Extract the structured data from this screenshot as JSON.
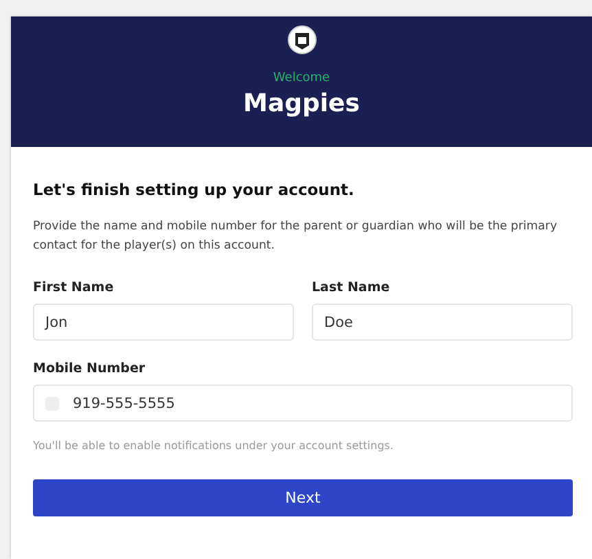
{
  "header": {
    "welcome": "Welcome",
    "title": "Magpies"
  },
  "form": {
    "heading": "Let's finish setting up your account.",
    "intro": "Provide the name and mobile number for the parent or guardian who will be the primary contact for the player(s) on this account.",
    "fields": [
      {
        "label": "First Name",
        "value": "Jon"
      },
      {
        "label": "Last Name",
        "value": "Doe"
      }
    ],
    "mobile": {
      "label": "Mobile Number",
      "value": "919-555-5555"
    },
    "hint": "You'll be able to enable notifications under your account settings.",
    "button": "Next"
  }
}
